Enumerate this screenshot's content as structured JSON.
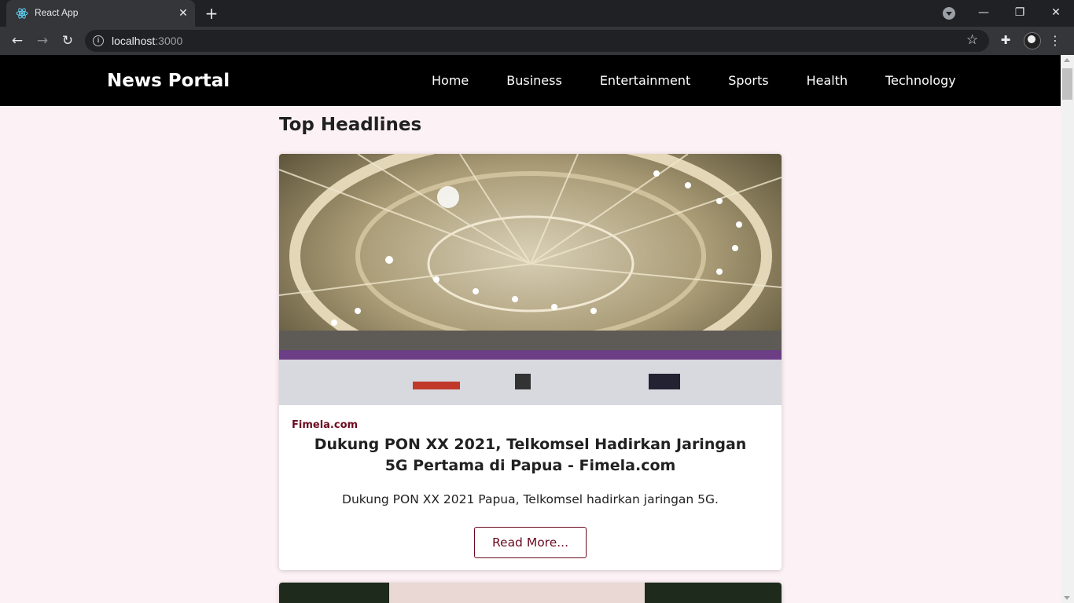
{
  "browser": {
    "tab_title": "React App",
    "url_host": "localhost",
    "url_port": ":3000"
  },
  "navbar": {
    "brand": "News Portal",
    "links": [
      "Home",
      "Business",
      "Entertainment",
      "Sports",
      "Health",
      "Technology"
    ]
  },
  "main": {
    "heading": "Top Headlines",
    "articles": [
      {
        "source": "Fimela.com",
        "title": "Dukung PON XX 2021, Telkomsel Hadirkan Jaringan 5G Pertama di Papua - Fimela.com",
        "description": "Dukung PON XX 2021 Papua, Telkomsel hadirkan jaringan 5G.",
        "button": "Read More..."
      }
    ]
  },
  "colors": {
    "page_bg": "#fcf1f4",
    "navbar_bg": "#000000",
    "accent": "#6b0a1f"
  },
  "icons": {
    "tab_favicon": "react-logo-icon",
    "back": "arrow-left-icon",
    "forward": "arrow-right-icon",
    "reload": "reload-icon",
    "site_info": "info-icon",
    "bookmark": "star-icon",
    "extensions": "puzzle-icon",
    "menu": "kebab-menu-icon"
  }
}
